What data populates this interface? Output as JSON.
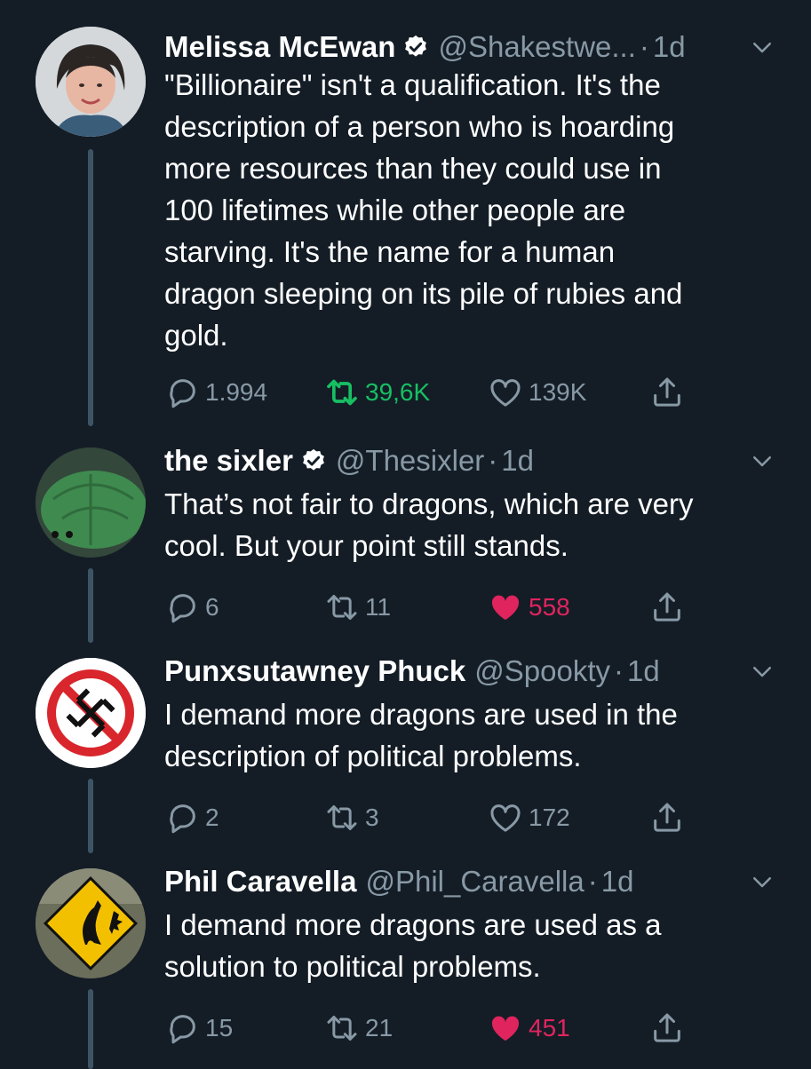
{
  "colors": {
    "background": "#141d26",
    "text_primary": "#ffffff",
    "text_secondary": "#8899a6",
    "retweet_active": "#17bf63",
    "like_active": "#e0245e",
    "verified": "#ffffff"
  },
  "tweets": [
    {
      "name": "Melissa McEwan",
      "verified": true,
      "handle": "@Shakestwe...",
      "separator": "·",
      "time": "1d",
      "lines": [
        "\"Billionaire\" isn't a qualification. It's the",
        "description of a person who is hoarding",
        "more resources than they could use in",
        "100 lifetimes while other people are",
        "starving. It's the name for a human",
        "dragon sleeping on its pile of rubies and",
        "gold."
      ],
      "replies": "1.994",
      "retweets": "39,6K",
      "likes": "139K",
      "retweeted": true,
      "liked": false,
      "avatar_icon": "person-avatar"
    },
    {
      "name": "the sixler",
      "verified": true,
      "handle": "@Thesixler",
      "separator": "·",
      "time": "1d",
      "lines": [
        "That’s not fair to dragons, which are very",
        "cool. But your point still stands."
      ],
      "replies": "6",
      "retweets": "11",
      "likes": "558",
      "retweeted": false,
      "liked": true,
      "avatar_icon": "turtle-avatar"
    },
    {
      "name": "Punxsutawney Phuck",
      "verified": false,
      "handle": "@Spookty",
      "separator": "·",
      "time": "1d",
      "lines": [
        "I demand more dragons are used in the",
        "description of political problems."
      ],
      "replies": "2",
      "retweets": "3",
      "likes": "172",
      "retweeted": false,
      "liked": false,
      "avatar_icon": "anti-symbol-avatar"
    },
    {
      "name": "Phil Caravella",
      "verified": false,
      "handle": "@Phil_Caravella",
      "separator": "·",
      "time": "1d",
      "lines": [
        "I demand more dragons are used as a",
        "solution to political problems."
      ],
      "replies": "15",
      "retweets": "21",
      "likes": "451",
      "retweeted": false,
      "liked": true,
      "avatar_icon": "kangaroo-sign-avatar"
    }
  ]
}
